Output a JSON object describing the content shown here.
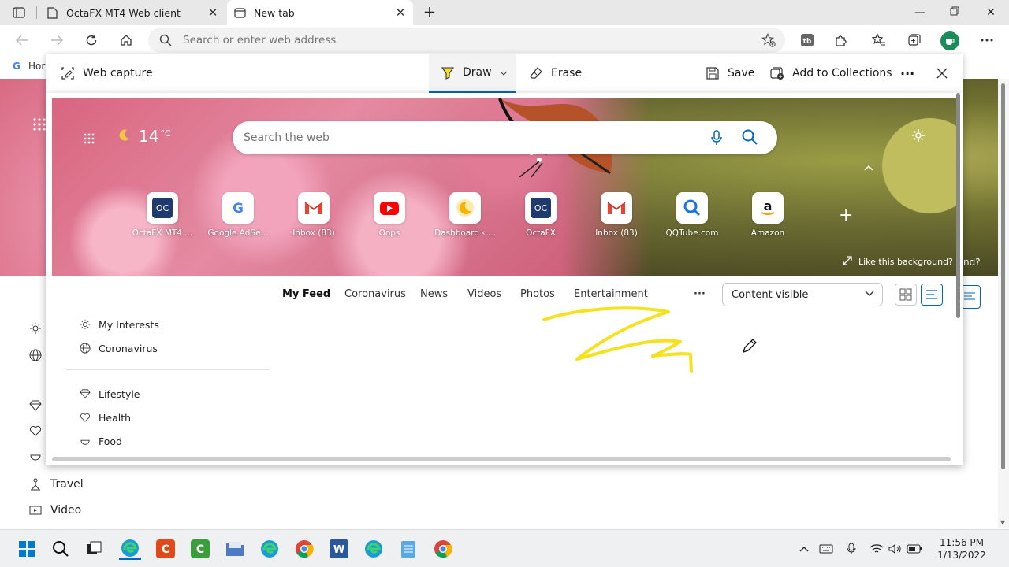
{
  "tabs": [
    {
      "title": "OctaFX MT4 Web client",
      "active": false
    },
    {
      "title": "New tab",
      "active": true
    }
  ],
  "address_bar": {
    "placeholder": "Search or enter web address"
  },
  "favorites_bar": {
    "item_label": "Hor"
  },
  "web_capture": {
    "title": "Web capture",
    "draw_label": "Draw",
    "erase_label": "Erase",
    "save_label": "Save",
    "collections_label": "Add to Collections",
    "more_label": "···"
  },
  "newtab": {
    "weather": {
      "temperature": "14",
      "unit": "°C"
    },
    "search_placeholder": "Search the web",
    "quick_links": [
      {
        "label": "OctaFX MT4 ...",
        "icon": "octafx-icon"
      },
      {
        "label": "Google AdSe...",
        "icon": "google-icon"
      },
      {
        "label": "Inbox (83)",
        "icon": "gmail-icon"
      },
      {
        "label": "Oops",
        "icon": "youtube-icon"
      },
      {
        "label": "Dashboard ‹ ...",
        "icon": "moon-icon"
      },
      {
        "label": "OctaFX",
        "icon": "octafx-icon"
      },
      {
        "label": "Inbox (83)",
        "icon": "gmail-icon"
      },
      {
        "label": "QQTube.com",
        "icon": "qqtube-icon"
      },
      {
        "label": "Amazon",
        "icon": "amazon-icon"
      }
    ],
    "like_background": "Like this background?",
    "partial_text": "nd?",
    "feed_tabs": [
      "My Feed",
      "Coronavirus",
      "News",
      "Videos",
      "Photos",
      "Entertainment"
    ],
    "feed_more": "···",
    "content_visibility": "Content visible",
    "sidebar": {
      "top": [
        {
          "label": "My Interests",
          "icon": "sun-icon"
        },
        {
          "label": "Coronavirus",
          "icon": "globe-icon"
        }
      ],
      "categories": [
        {
          "label": "Lifestyle",
          "icon": "diamond-icon"
        },
        {
          "label": "Health",
          "icon": "heart-icon"
        },
        {
          "label": "Food",
          "icon": "food-icon"
        }
      ]
    }
  },
  "background_page": {
    "sidebar": [
      {
        "label": "Travel",
        "icon": "travel-icon"
      },
      {
        "label": "Video",
        "icon": "video-icon"
      }
    ]
  },
  "taskbar": {
    "apps": [
      "start",
      "search",
      "task-view",
      "edge",
      "app-orange",
      "camtasia",
      "file-explorer",
      "edge-2",
      "chrome",
      "word",
      "edge-3",
      "notepad",
      "chrome-2"
    ],
    "time": "11:56 PM",
    "date": "1/13/2022"
  },
  "colors": {
    "accent": "#0067c0",
    "highlighter": "#f5e11e"
  }
}
